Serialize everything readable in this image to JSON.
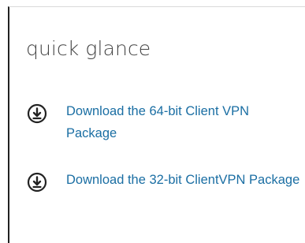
{
  "quick_glance": {
    "title": "quick glance",
    "links": [
      {
        "label": "Download the 64-bit Client VPN Package",
        "icon": "download-circle-icon"
      },
      {
        "label": "Download the 32-bit ClientVPN Package",
        "icon": "download-circle-icon"
      }
    ]
  },
  "colors": {
    "link": "#1a6ea3",
    "title": "#444444",
    "icon": "#222222"
  }
}
